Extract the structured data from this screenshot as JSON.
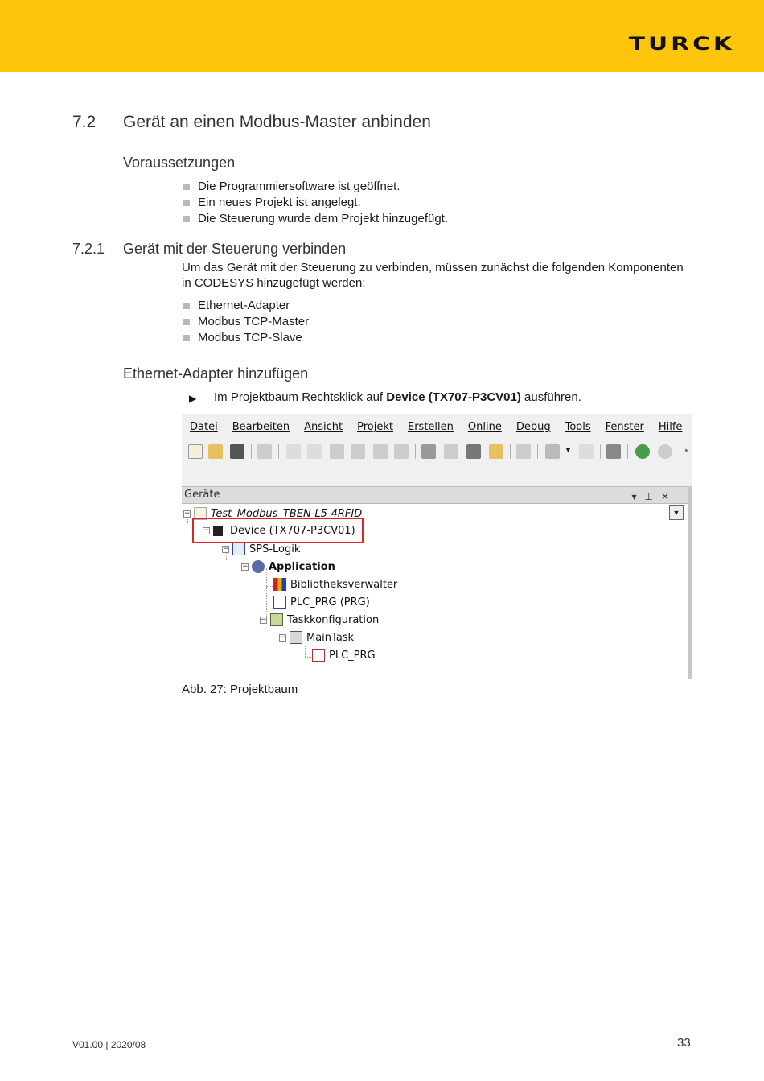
{
  "brand": {
    "logo": "TURCK",
    "color": "#fdc60d"
  },
  "section": {
    "number": "7.2",
    "title": "Gerät an einen Modbus-Master anbinden"
  },
  "prereq": {
    "heading": "Voraussetzungen",
    "items": [
      "Die Programmiersoftware ist geöffnet.",
      "Ein neues Projekt ist angelegt.",
      "Die Steuerung wurde dem Projekt hinzugefügt."
    ]
  },
  "subsection": {
    "number": "7.2.1",
    "title": "Gerät mit der Steuerung verbinden",
    "intro_line1": "Um das Gerät mit der Steuerung zu verbinden, müssen zunächst die folgenden Komponenten",
    "intro_line2": "in CODESYS hinzugefügt werden:",
    "items": [
      "Ethernet-Adapter",
      "Modbus TCP-Master",
      "Modbus TCP-Slave"
    ]
  },
  "ethernet": {
    "heading": "Ethernet-Adapter hinzufügen",
    "step_prefix": "Im Projektbaum Rechtsklick auf ",
    "step_bold": "Device (TX707-P3CV01)",
    "step_suffix": " ausführen."
  },
  "screenshot": {
    "menu": [
      "Datei",
      "Bearbeiten",
      "Ansicht",
      "Projekt",
      "Erstellen",
      "Online",
      "Debug",
      "Tools",
      "Fenster",
      "Hilfe"
    ],
    "panel_title": "Geräte",
    "tree": {
      "project": "Test_Modbus_TBEN-L5-4RFID",
      "device": "Device (TX707-P3CV01)",
      "sps": "SPS-Logik",
      "application": "Application",
      "library": "Bibliotheksverwalter",
      "plc_prg": "PLC_PRG (PRG)",
      "taskconfig": "Taskkonfiguration",
      "maintask": "MainTask",
      "plc_prg_call": "PLC_PRG"
    }
  },
  "caption": "Abb. 27: Projektbaum",
  "footer": {
    "version": "V01.00 | 2020/08",
    "page": "33"
  }
}
